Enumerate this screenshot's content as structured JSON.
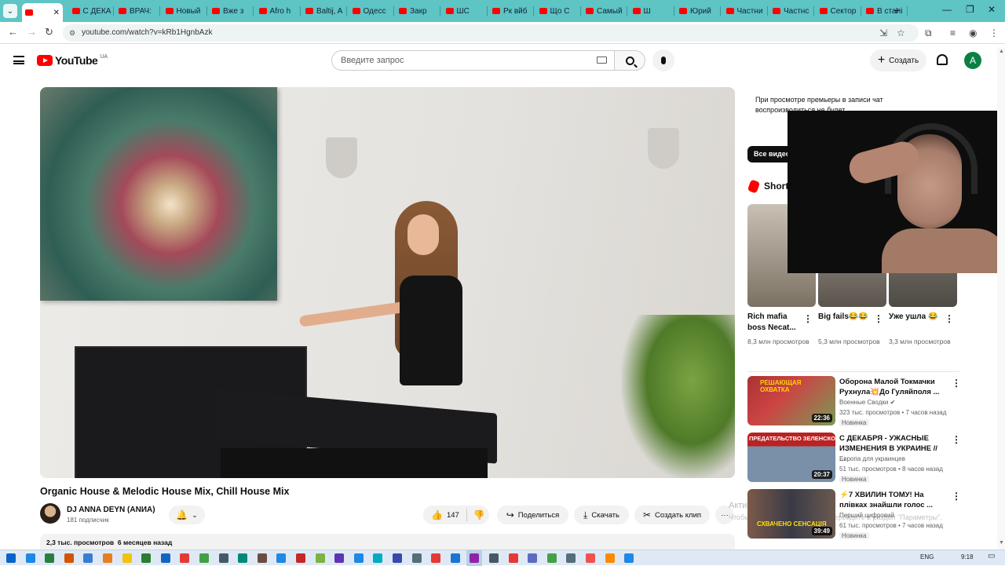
{
  "browser": {
    "tabs": [
      {
        "label": ""
      },
      {
        "label": "С ДЕКА"
      },
      {
        "label": "ВРАЧ: "
      },
      {
        "label": "Новый "
      },
      {
        "label": "Вже з"
      },
      {
        "label": "Afro h"
      },
      {
        "label": "Baltij, A"
      },
      {
        "label": "Одесс"
      },
      {
        "label": "Закр"
      },
      {
        "label": "ШС"
      },
      {
        "label": "Рк вйб"
      },
      {
        "label": "Що С"
      },
      {
        "label": "Самый"
      },
      {
        "label": "Ш"
      },
      {
        "label": "Юрий "
      },
      {
        "label": "Частни"
      },
      {
        "label": "Частнс"
      },
      {
        "label": "Сектор"
      },
      {
        "label": "В сталі"
      }
    ],
    "url": "youtube.com/watch?v=kRb1HgnbAzk"
  },
  "header": {
    "logo_text": "YouTube",
    "region": "UA",
    "search_placeholder": "Введите запрос",
    "create_label": "Создать",
    "avatar_letter": "A"
  },
  "video": {
    "title": "Organic House & Melodic House Mix, Chill House Mix",
    "channel_name": "DJ ANNA DEYN (ANИA)",
    "subscribers": "181 подписчик",
    "likes": "147",
    "share_label": "Поделиться",
    "download_label": "Скачать",
    "clip_label": "Создать клип",
    "more_label": "···",
    "views": "2,3 тыс. просмотров",
    "age": "6 месяцев назад"
  },
  "watermark": {
    "line1": "Активация Windows",
    "line2": "Чтобы активировать Windows, перейдите в раздел \"Параметры\"."
  },
  "sidebar": {
    "chat_note": "При просмотре премьеры в записи чат воспроизводиться не будет.",
    "all_videos_label": "Все видео",
    "shorts_title": "Shorts",
    "shorts": [
      {
        "title": "Rich mafia boss Necat...",
        "views": "8,3 млн просмотров"
      },
      {
        "title": "Big fails😂😂",
        "views": "5,3 млн просмотров"
      },
      {
        "title": "Уже ушла 😂",
        "views": "3,3 млн просмотров"
      }
    ],
    "recommendations": [
      {
        "title": "Оборона Малой Токмачки Рухнула💥До Гуляйполя ...",
        "channel": "Военные Сводки ✔",
        "meta": "323 тыс. просмотров • 7 часов назад",
        "badge": "Новинка",
        "duration": "22:36",
        "thumb_text": "РЕШАЮЩАЯ ОХВАТКА"
      },
      {
        "title": "С ДЕКАБРЯ - УЖАСНЫЕ ИЗМЕНЕНИЯ В УКРАИНЕ // ...",
        "channel": "Европа для украинцев",
        "meta": "51 тыс. просмотров • 8 часов назад",
        "badge": "Новинка",
        "duration": "20:37",
        "thumb_text": "ПРЕДАТЕЛЬСТВО ЗЕЛЕНСКОГО"
      },
      {
        "title": "⚡7 ХВИЛИН ТОМУ! На плівках знайшли голос ...",
        "channel": "Перший цифровий",
        "meta": "61 тыс. просмотров • 7 часов назад",
        "badge": "Новинка",
        "duration": "39:49",
        "thumb_text": "СХВАЧЕНО СЕНСАЦІЯ"
      }
    ]
  },
  "taskbar": {
    "lang": "ENG",
    "time": "9:18"
  }
}
